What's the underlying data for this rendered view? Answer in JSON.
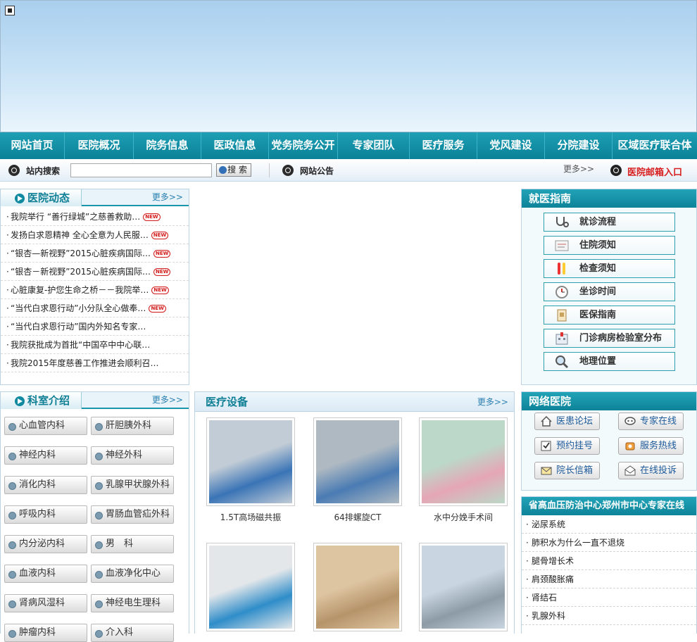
{
  "nav": [
    "网站首页",
    "医院概况",
    "院务信息",
    "医政信息",
    "党务院务公开",
    "专家团队",
    "医疗服务",
    "党风建设",
    "分院建设",
    "区域医疗联合体"
  ],
  "search": {
    "label": "站内搜索",
    "button": "搜 索",
    "notice_label": "网站公告",
    "more": "更多>>",
    "mailbox": "医院邮箱入口"
  },
  "news": {
    "title": "医院动态",
    "more": "更多>>",
    "items": [
      {
        "text": "我院举行 “善行绿城”之慈善救助…",
        "badge": "NEW"
      },
      {
        "text": "发扬白求恩精神 全心全意为人民服…",
        "badge": "NEW"
      },
      {
        "text": "“银杏—新视野”2015心脏疾病国际…",
        "badge": "NEW"
      },
      {
        "text": "“银杏－新视野”2015心脏疾病国际…",
        "badge": "NEW"
      },
      {
        "text": "心脏康复-护您生命之桥－－我院举…",
        "badge": "NEW"
      },
      {
        "text": "“当代白求恩行动”小分队全心做奉…",
        "badge": "NEW"
      },
      {
        "text": "“当代白求恩行动”国内外知名专家…",
        "badge": ""
      },
      {
        "text": "我院获批成为首批“中国卒中中心联…",
        "badge": ""
      },
      {
        "text": "我院2015年度慈善工作推进会顺利召…",
        "badge": ""
      }
    ]
  },
  "guide": {
    "title": "就医指南",
    "items": [
      {
        "label": "就诊流程",
        "icon": "stethoscope-icon"
      },
      {
        "label": "住院须知",
        "icon": "document-icon"
      },
      {
        "label": "检查须知",
        "icon": "test-tube-icon"
      },
      {
        "label": "坐诊时间",
        "icon": "clock-icon"
      },
      {
        "label": "医保指南",
        "icon": "insurance-icon"
      },
      {
        "label": "门诊病房检验室分布",
        "icon": "building-icon"
      },
      {
        "label": "地理位置",
        "icon": "magnifier-icon"
      }
    ]
  },
  "depts": {
    "title": "科室介绍",
    "more": "更多>>",
    "items": [
      "心血管内科",
      "肝胆胰外科",
      "神经内科",
      "神经外科",
      "消化内科",
      "乳腺甲状腺外科",
      "呼吸内科",
      "胃肠血管疝外科",
      "内分泌内科",
      "男　科",
      "血液内科",
      "血液净化中心",
      "肾病风湿科",
      "神经电生理科",
      "肿瘤内科",
      "介入科"
    ]
  },
  "equipment": {
    "title": "医疗设备",
    "more": "更多>>",
    "items": [
      {
        "caption": "1.5T高场磁共振",
        "colors": [
          "#c2ccd6",
          "#3a74b6"
        ]
      },
      {
        "caption": "64排螺旋CT",
        "colors": [
          "#aeb9c2",
          "#4a7bb3"
        ]
      },
      {
        "caption": "水中分娩手术间",
        "colors": [
          "#bcd8c8",
          "#e5a6b5"
        ]
      },
      {
        "caption": "",
        "colors": [
          "#e3e7ea",
          "#2f8dc9"
        ]
      },
      {
        "caption": "",
        "colors": [
          "#dec5a1",
          "#b6946a"
        ]
      },
      {
        "caption": "",
        "colors": [
          "#c9d6e2",
          "#8c9ba6"
        ]
      }
    ]
  },
  "network": {
    "title": "网络医院",
    "items": [
      {
        "label": "医患论坛",
        "icon": "home-icon"
      },
      {
        "label": "专家在线",
        "icon": "chat-icon"
      },
      {
        "label": "预约挂号",
        "icon": "checkbox-icon"
      },
      {
        "label": "服务热线",
        "icon": "phone-icon"
      },
      {
        "label": "院长信箱",
        "icon": "mail-icon"
      },
      {
        "label": "在线投诉",
        "icon": "envelope-open-icon"
      }
    ]
  },
  "experts": {
    "title": "省高血压防治中心郑州市中心专家在线",
    "items": [
      "泌尿系统",
      "肺积水为什么一直不退烧",
      "腿骨增长术",
      "肩颈酸胀痛",
      "肾结石",
      "乳腺外科"
    ]
  }
}
